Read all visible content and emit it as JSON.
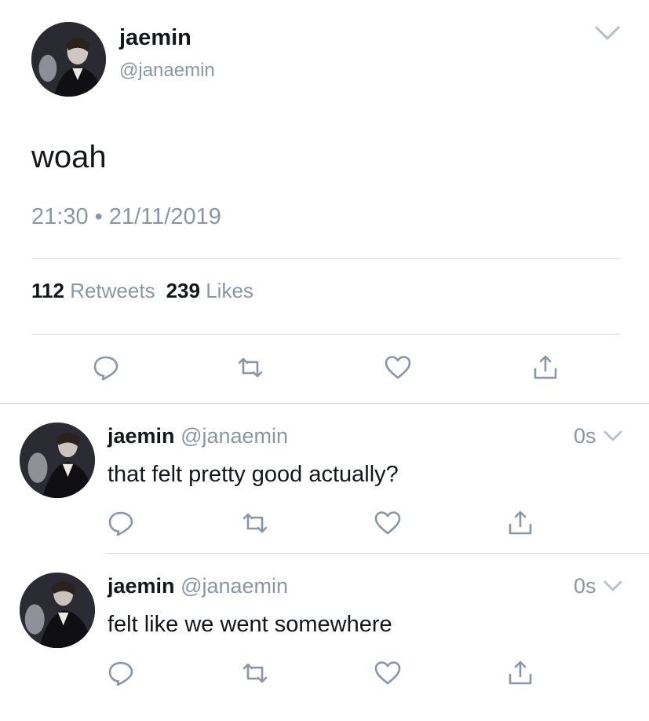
{
  "tweet": {
    "display_name": "jaemin",
    "handle": "@janaemin",
    "text": "woah",
    "timestamp": "21:30 • 21/11/2019",
    "retweet_count": "112",
    "retweet_label": "Retweets",
    "like_count": "239",
    "like_label": "Likes",
    "actions": [
      "reply-icon",
      "retweet-icon",
      "like-icon",
      "share-icon"
    ]
  },
  "replies": [
    {
      "display_name": "jaemin",
      "handle": "@janaemin",
      "time": "0s",
      "text": "that felt pretty good actually?"
    },
    {
      "display_name": "jaemin",
      "handle": "@janaemin",
      "time": "0s",
      "text": "felt like we went somewhere"
    }
  ],
  "colors": {
    "text": "#14171a",
    "secondary": "#8a96a3",
    "divider": "#d6dbe0"
  }
}
